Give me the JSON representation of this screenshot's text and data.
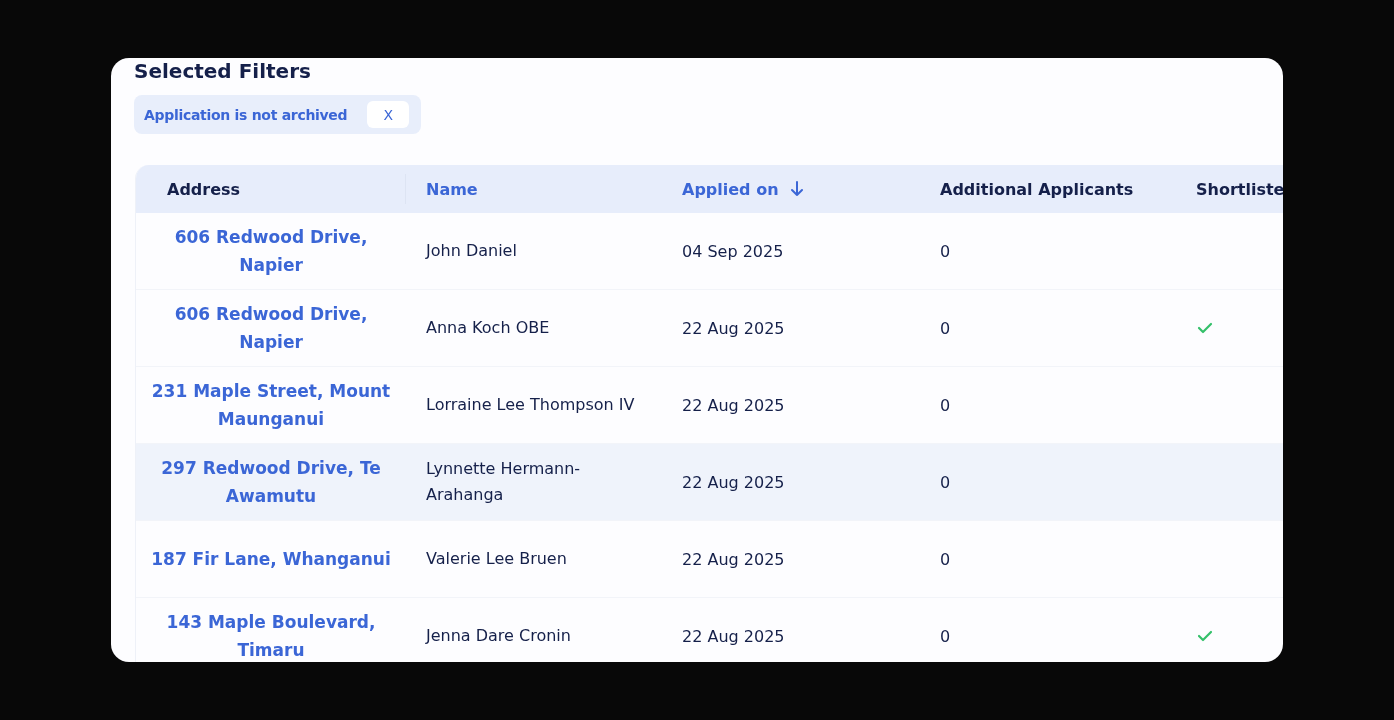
{
  "title": "Selected Filters",
  "filters": [
    {
      "label": "Application is not archived",
      "remove": "X"
    }
  ],
  "table": {
    "columns": [
      {
        "label": "Address",
        "sortable": false,
        "sorted": false
      },
      {
        "label": "Name",
        "sortable": true,
        "sorted": false
      },
      {
        "label": "Applied on",
        "sortable": true,
        "sorted": true
      },
      {
        "label": "Additional Applicants",
        "sortable": false,
        "sorted": false
      },
      {
        "label": "Shortliste",
        "sortable": false,
        "sorted": false
      }
    ],
    "rows": [
      {
        "address": "606 Redwood Drive, Napier",
        "name": "John Daniel",
        "applied_on": "04 Sep 2025",
        "additional_applicants": "0",
        "shortlisted": false,
        "hovered": false
      },
      {
        "address": "606 Redwood Drive, Napier",
        "name": "Anna Koch OBE",
        "applied_on": "22 Aug 2025",
        "additional_applicants": "0",
        "shortlisted": true,
        "hovered": false
      },
      {
        "address": "231 Maple Street, Mount Maunganui",
        "name": "Lorraine Lee Thompson IV",
        "applied_on": "22 Aug 2025",
        "additional_applicants": "0",
        "shortlisted": false,
        "hovered": false
      },
      {
        "address": "297 Redwood Drive, Te Awamutu",
        "name": "Lynnette Hermann-Arahanga",
        "applied_on": "22 Aug 2025",
        "additional_applicants": "0",
        "shortlisted": false,
        "hovered": true
      },
      {
        "address": "187 Fir Lane, Whanganui",
        "name": "Valerie Lee Bruen",
        "applied_on": "22 Aug 2025",
        "additional_applicants": "0",
        "shortlisted": false,
        "hovered": false
      },
      {
        "address": "143 Maple Boulevard, Timaru",
        "name": "Jenna Dare Cronin",
        "applied_on": "22 Aug 2025",
        "additional_applicants": "0",
        "shortlisted": true,
        "hovered": false
      }
    ]
  }
}
